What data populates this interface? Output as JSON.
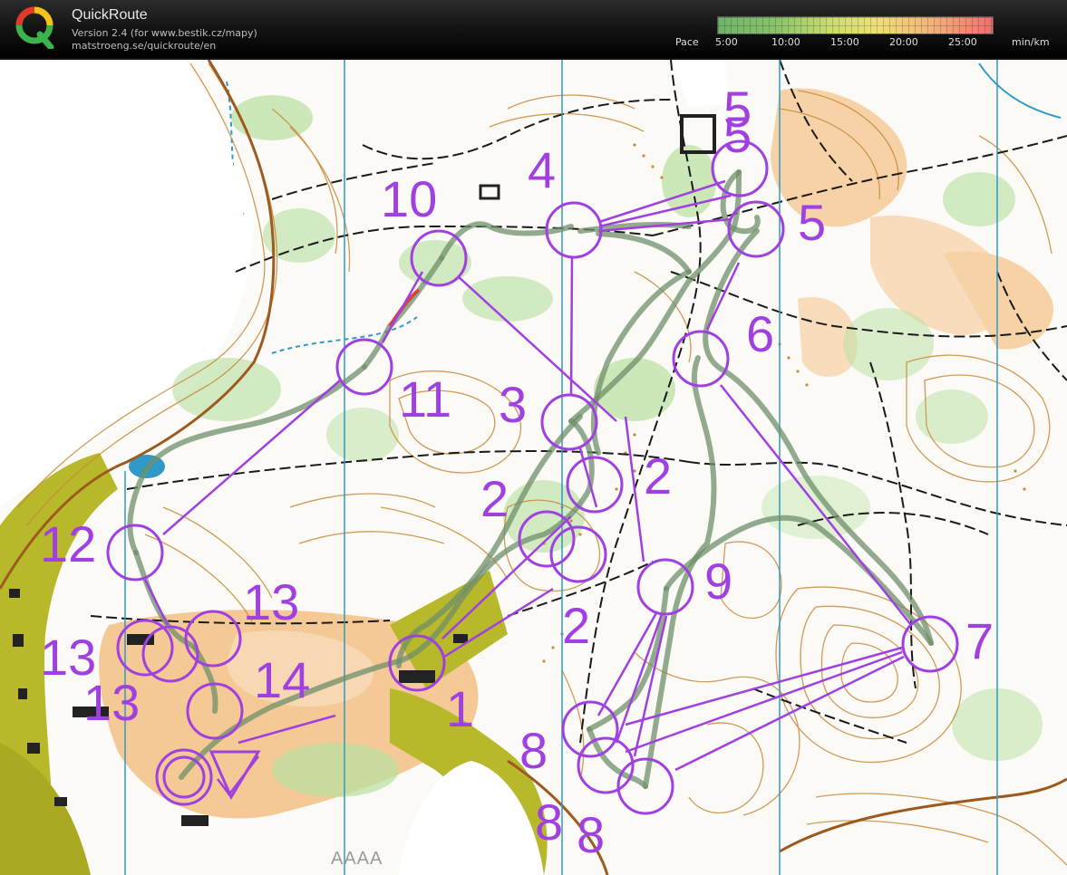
{
  "app": {
    "title": "QuickRoute",
    "version_line": "Version 2.4  (for www.bestik.cz/mapy)",
    "url_line": "matstroeng.se/quickroute/en"
  },
  "pace_scale": {
    "label": "Pace",
    "unit": "min/km",
    "ticks": [
      "5:00",
      "10:00",
      "15:00",
      "20:00",
      "25:00"
    ],
    "colors": [
      "#6fb36b",
      "#c8dc70",
      "#eee07a",
      "#f2b27a",
      "#ee6e6e"
    ]
  },
  "map": {
    "course_color": "#a040e0",
    "route_color": "#6f8f6a",
    "watermark": "AAAA",
    "controls": [
      {
        "label": "1"
      },
      {
        "label": "2"
      },
      {
        "label": "2"
      },
      {
        "label": "2"
      },
      {
        "label": "3"
      },
      {
        "label": "4"
      },
      {
        "label": "5"
      },
      {
        "label": "5"
      },
      {
        "label": "5"
      },
      {
        "label": "6"
      },
      {
        "label": "7"
      },
      {
        "label": "8"
      },
      {
        "label": "8"
      },
      {
        "label": "8"
      },
      {
        "label": "9"
      },
      {
        "label": "10"
      },
      {
        "label": "11"
      },
      {
        "label": "12"
      },
      {
        "label": "13"
      },
      {
        "label": "13"
      },
      {
        "label": "13"
      },
      {
        "label": "14"
      }
    ]
  }
}
